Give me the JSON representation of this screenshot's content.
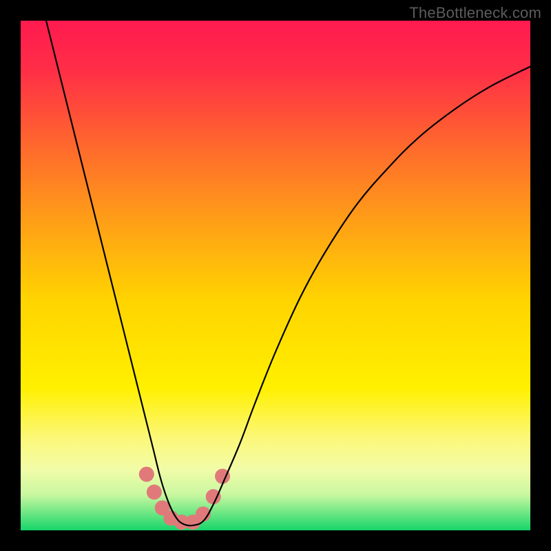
{
  "watermark": "TheBottleneck.com",
  "chart_data": {
    "type": "line",
    "title": "",
    "xlabel": "",
    "ylabel": "",
    "xlim": [
      0,
      100
    ],
    "ylim": [
      0,
      100
    ],
    "grid": false,
    "legend": false,
    "background_gradient_stops": [
      {
        "offset": 0.0,
        "color": "#ff1a4f"
      },
      {
        "offset": 0.1,
        "color": "#ff2f46"
      },
      {
        "offset": 0.25,
        "color": "#ff6a2c"
      },
      {
        "offset": 0.4,
        "color": "#ffa116"
      },
      {
        "offset": 0.55,
        "color": "#ffd400"
      },
      {
        "offset": 0.72,
        "color": "#fff000"
      },
      {
        "offset": 0.82,
        "color": "#fcf87a"
      },
      {
        "offset": 0.88,
        "color": "#f2fca8"
      },
      {
        "offset": 0.93,
        "color": "#c9f7a0"
      },
      {
        "offset": 0.965,
        "color": "#6fe884"
      },
      {
        "offset": 1.0,
        "color": "#17d46b"
      }
    ],
    "series": [
      {
        "name": "bottleneck-curve",
        "color": "#000000",
        "stroke_width": 2.2,
        "x": [
          5.0,
          7,
          9,
          11,
          13,
          15,
          17,
          19,
          21,
          23,
          24.5,
          26,
          27.5,
          29,
          30.5,
          32,
          34,
          36,
          38,
          40,
          43,
          46,
          50,
          55,
          60,
          66,
          72,
          78,
          85,
          92,
          100
        ],
        "y": [
          100,
          92,
          84,
          76,
          68,
          60,
          52,
          44,
          36,
          28,
          22,
          16,
          10,
          5.5,
          2.5,
          1.2,
          1.0,
          2.0,
          5.5,
          10,
          17,
          25,
          35,
          46,
          55,
          64,
          71,
          77,
          82.5,
          87,
          91
        ]
      }
    ],
    "markers": [
      {
        "x": 24.7,
        "y": 11.0
      },
      {
        "x": 26.2,
        "y": 7.5
      },
      {
        "x": 27.8,
        "y": 4.4
      },
      {
        "x": 29.5,
        "y": 2.4
      },
      {
        "x": 31.6,
        "y": 1.6
      },
      {
        "x": 33.8,
        "y": 1.6
      },
      {
        "x": 35.8,
        "y": 3.2
      },
      {
        "x": 37.8,
        "y": 6.6
      },
      {
        "x": 39.6,
        "y": 10.6
      }
    ],
    "marker_style": {
      "color": "#e07a7a",
      "radius_px": 11
    }
  }
}
